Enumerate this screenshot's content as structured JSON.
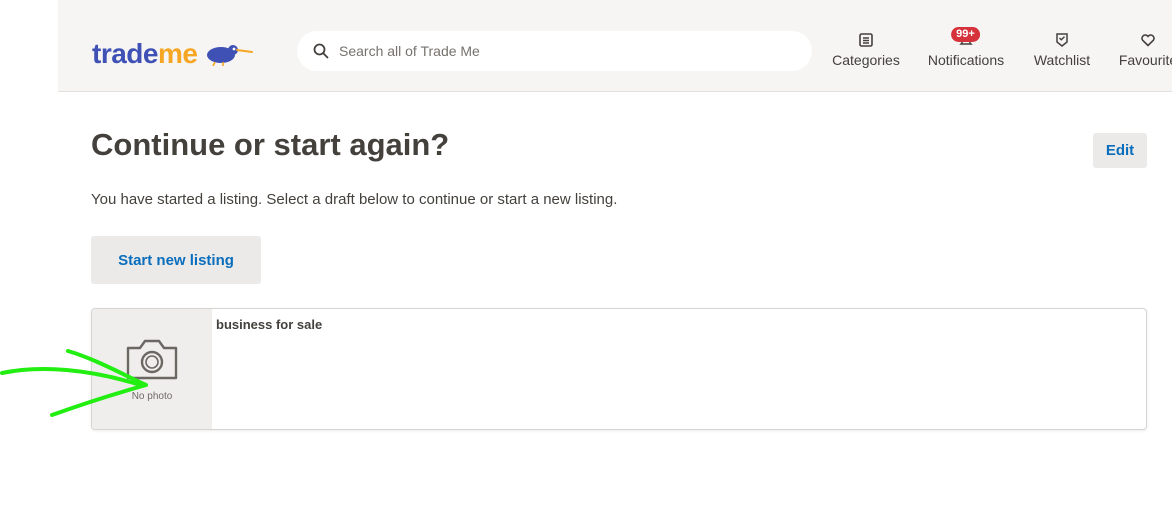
{
  "header": {
    "logo": {
      "part1": "trade",
      "part2": "me"
    },
    "search": {
      "placeholder": "Search all of Trade Me",
      "value": ""
    },
    "nav": [
      {
        "label": "Categories",
        "icon": "list-icon"
      },
      {
        "label": "Notifications",
        "icon": "bell-icon",
        "badge": "99+"
      },
      {
        "label": "Watchlist",
        "icon": "watchlist-icon"
      },
      {
        "label": "Favourite",
        "icon": "heart-icon"
      }
    ]
  },
  "main": {
    "title": "Continue or start again?",
    "edit_label": "Edit",
    "intro": "You have started a listing. Select a draft below to continue or start a new listing.",
    "start_label": "Start new listing",
    "draft": {
      "title": "business for sale",
      "no_photo_label": "No photo",
      "icon": "camera-icon"
    }
  },
  "colors": {
    "brand_blue": "#3f51b5",
    "brand_orange": "#f5a623",
    "link_blue": "#0a6ebd",
    "badge_red": "#d6323b",
    "annotation_green": "#22ee11"
  }
}
